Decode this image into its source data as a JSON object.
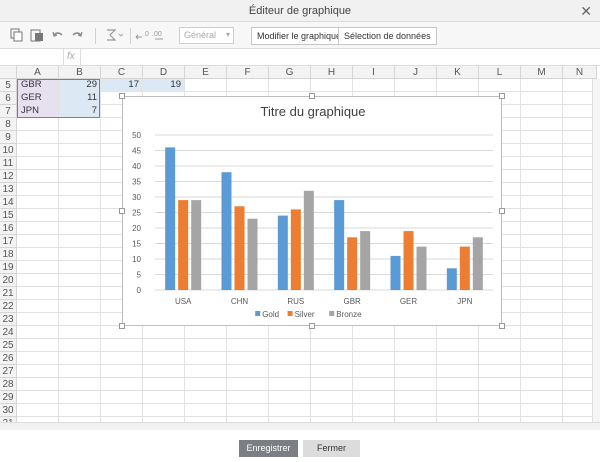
{
  "window": {
    "title": "Éditeur de graphique",
    "close_glyph": "✕"
  },
  "toolbar": {
    "format_value": "Général",
    "modify_chart_label": "Modifier le graphique",
    "select_data_label": "Sélection de données",
    "icons": [
      "copy-icon",
      "paste-icon",
      "undo-icon",
      "redo-icon",
      "sum-icon",
      "decrease-decimal-icon",
      "increase-decimal-icon"
    ]
  },
  "formula_bar": {
    "fx_label": "fx",
    "value": ""
  },
  "sheet": {
    "columns": [
      "A",
      "B",
      "C",
      "D",
      "E",
      "F",
      "G",
      "H",
      "I",
      "J",
      "K",
      "L",
      "M",
      "N"
    ],
    "rows": [
      "5",
      "6",
      "7",
      "8",
      "9",
      "10",
      "11",
      "12",
      "13",
      "14",
      "15",
      "16",
      "17",
      "18",
      "19",
      "20",
      "21",
      "22",
      "23",
      "24",
      "25",
      "26",
      "27",
      "28",
      "29",
      "30",
      "31"
    ],
    "data": [
      {
        "country": "GBR",
        "b": "29",
        "c": "17",
        "d": "19"
      },
      {
        "country": "GER",
        "b": "11",
        "c": "",
        "d": ""
      },
      {
        "country": "JPN",
        "b": "7",
        "c": "",
        "d": ""
      }
    ]
  },
  "chart_data": {
    "type": "bar",
    "title": "Titre du graphique",
    "categories": [
      "USA",
      "CHN",
      "RUS",
      "GBR",
      "GER",
      "JPN"
    ],
    "series": [
      {
        "name": "Gold",
        "color": "#5b9bd5",
        "values": [
          46,
          38,
          24,
          29,
          11,
          7
        ]
      },
      {
        "name": "Silver",
        "color": "#ed7d31",
        "values": [
          29,
          27,
          26,
          17,
          19,
          14
        ]
      },
      {
        "name": "Bronze",
        "color": "#a5a5a5",
        "values": [
          29,
          23,
          32,
          19,
          14,
          17
        ]
      }
    ],
    "ylim": [
      0,
      50
    ],
    "yticks": [
      "0",
      "5",
      "10",
      "15",
      "20",
      "25",
      "30",
      "35",
      "40",
      "45",
      "50"
    ],
    "grid": true,
    "legend": "bottom"
  },
  "footer": {
    "save_label": "Enregistrer",
    "close_label": "Fermer"
  }
}
